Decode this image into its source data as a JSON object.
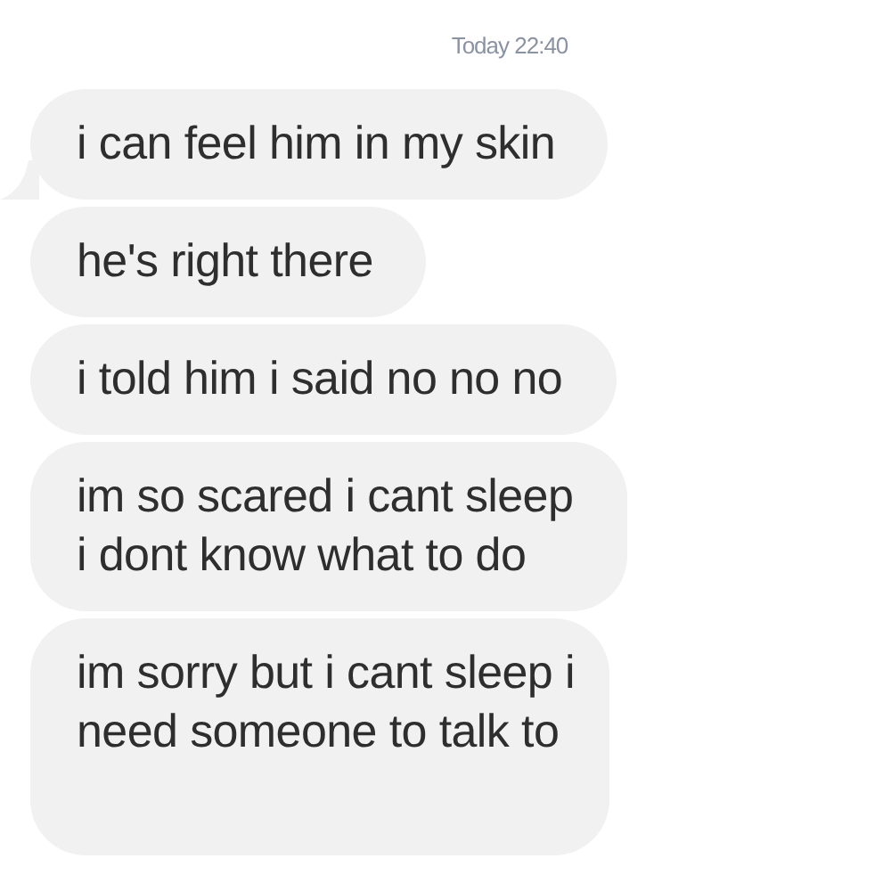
{
  "timestamp": "Today 22:40",
  "messages": [
    {
      "text": "i can feel him in my skin",
      "tail": true
    },
    {
      "text": "he's right there",
      "tail": false
    },
    {
      "text": "i told him i said no no no",
      "tail": false
    },
    {
      "text": "im so scared i cant sleep\ni dont know what to do",
      "tail": false
    },
    {
      "text": "im sorry but i cant sleep i\nneed someone to talk to",
      "tail": false
    }
  ]
}
